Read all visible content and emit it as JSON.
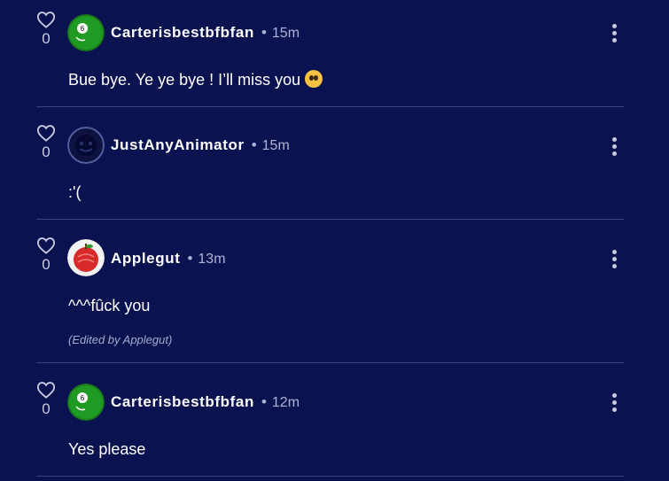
{
  "comments": [
    {
      "username": "Carterisbestbfbfan",
      "time": "15m",
      "likes": "0",
      "text": "Bue bye. Ye ye bye ! I’ll miss you",
      "avatar": "green-8-ball-avatar"
    },
    {
      "username": "JustAnyAnimator",
      "time": "15m",
      "likes": "0",
      "text": ":'(",
      "avatar": "dark-face-avatar"
    },
    {
      "username": "Applegut",
      "time": "13m",
      "likes": "0",
      "text": "^^^fûck you",
      "edited": "(Edited by Applegut)",
      "avatar": "apple-avatar"
    },
    {
      "username": "Carterisbestbfbfan",
      "time": "12m",
      "likes": "0",
      "text": "Yes please",
      "avatar": "green-8-ball-avatar"
    }
  ],
  "separator": "•",
  "emoji": "pleading-face-emoji",
  "colors": {
    "background": "#0b1250",
    "divider": "#3d4478",
    "meta": "#aeb3d6"
  }
}
